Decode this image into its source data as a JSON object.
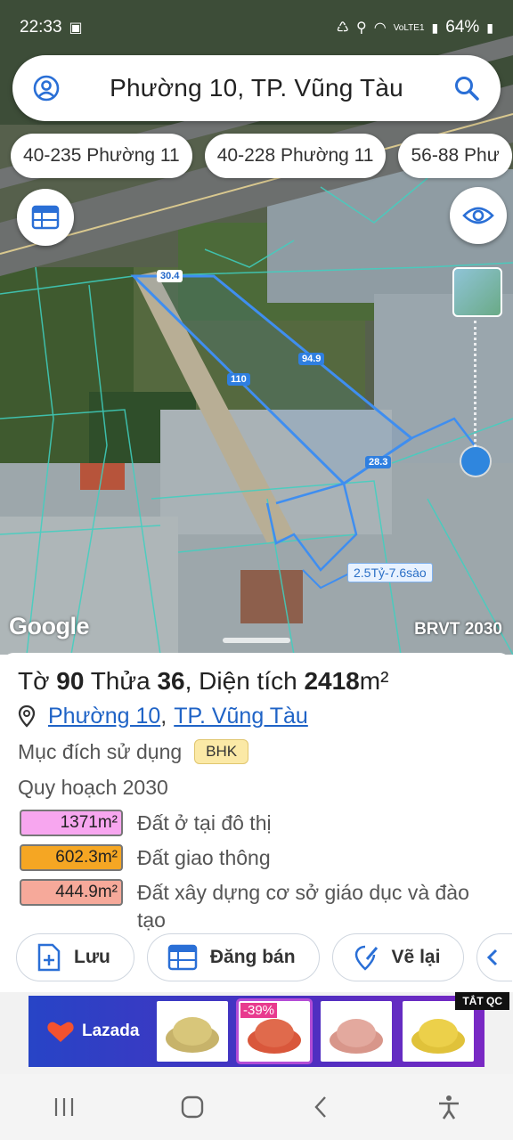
{
  "status": {
    "time": "22:33",
    "battery": "64%",
    "network": "VoLTE1"
  },
  "search": {
    "title": "Phường 10, TP. Vũng Tàu"
  },
  "chips": [
    {
      "label": "40-235 Phường 11"
    },
    {
      "label": "40-228 Phường 11"
    },
    {
      "label": "56-88 Phư"
    }
  ],
  "map": {
    "edge_labels": [
      "30.4",
      "94.9",
      "110",
      "28.3"
    ],
    "price_tag": "2.5Tỷ-7.6sào",
    "google": "Google",
    "layer_code": "BRVT 2030"
  },
  "plot": {
    "to_label": "Tờ",
    "to_value": "90",
    "thua_label": "Thửa",
    "thua_value": "36",
    "area_label": ", Diện tích",
    "area_value": "2418",
    "area_unit": "m²",
    "ward": "Phường 10",
    "city": "TP. Vũng Tàu",
    "purpose_label": "Mục đích sử dụng",
    "purpose_code": "BHK",
    "plan_label": "Quy hoạch 2030",
    "plan_items": [
      {
        "area": "1371m²",
        "label": "Đất ở tại đô thị",
        "color": "#f7a6ef"
      },
      {
        "area": "602.3m²",
        "label": "Đất giao thông",
        "color": "#f5a623"
      },
      {
        "area": "444.9m²",
        "label": "Đất xây dựng cơ sở giáo dục và đào tạo",
        "color": "#f6a99a"
      }
    ]
  },
  "actions": {
    "save": "Lưu",
    "post": "Đăng bán",
    "redraw": "Vẽ lại"
  },
  "ad": {
    "brand": "Lazada",
    "discount": "-39%",
    "close": "TẮT QC"
  }
}
